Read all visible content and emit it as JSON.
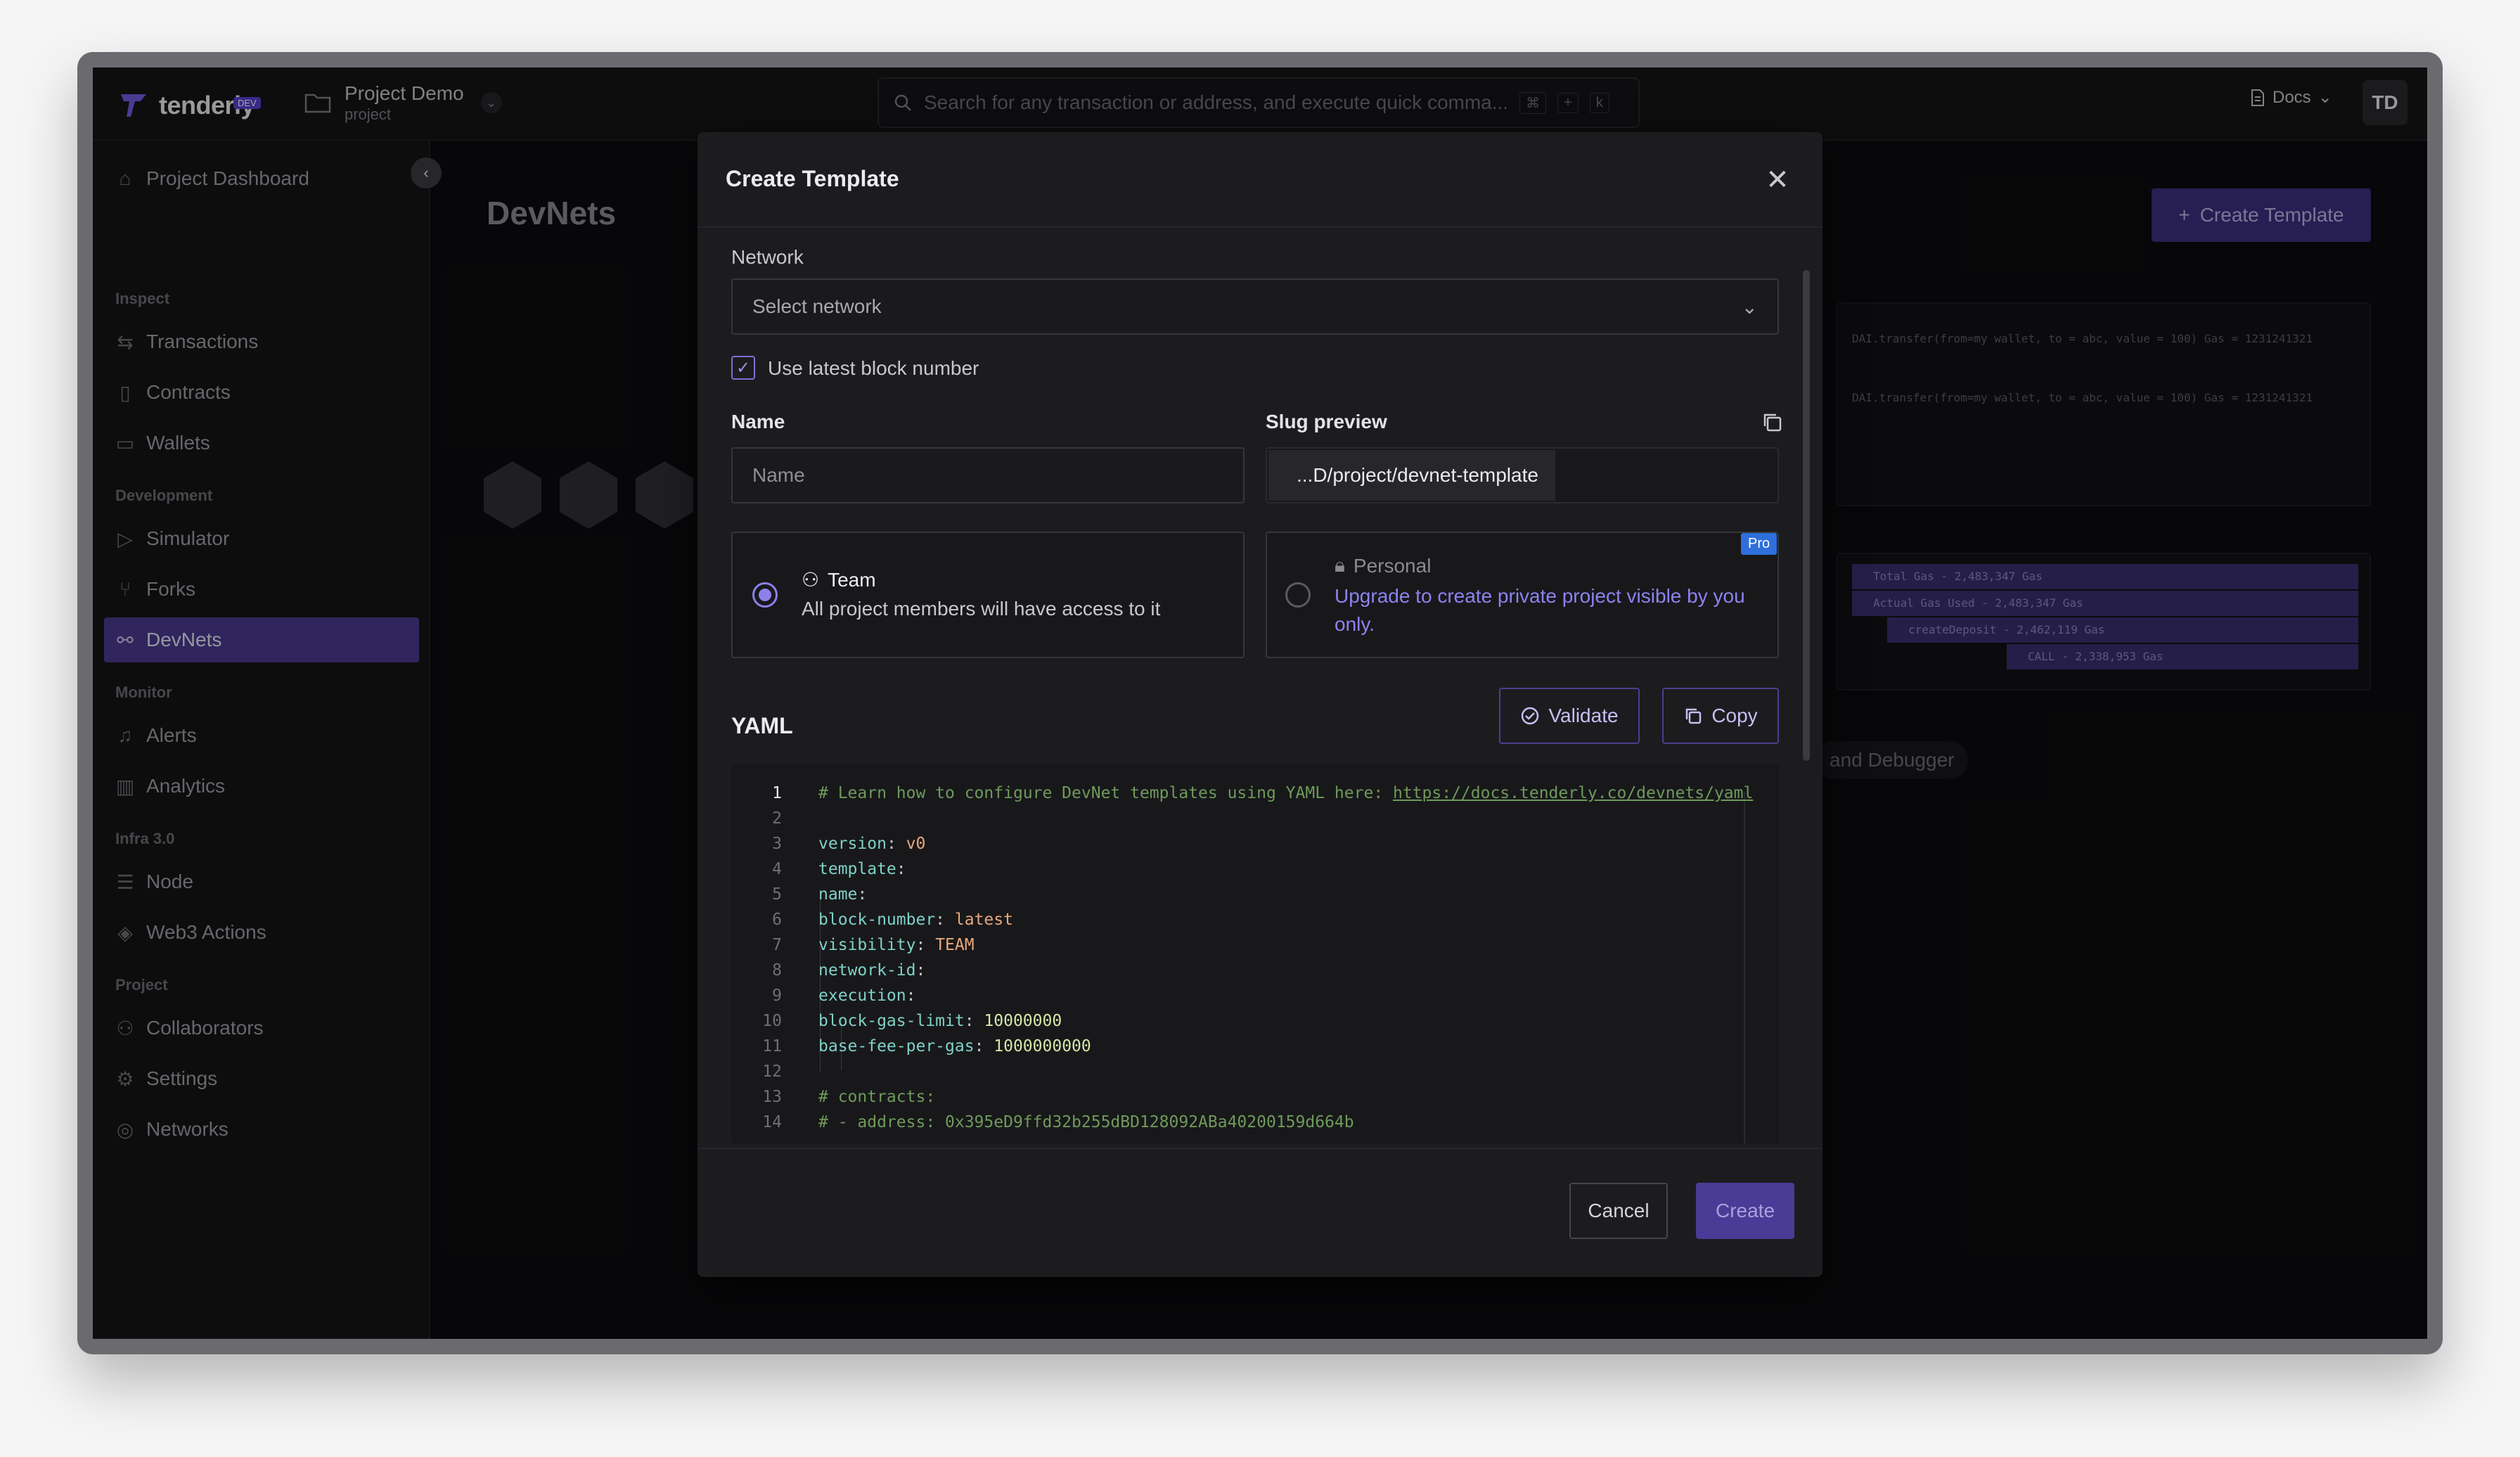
{
  "app": {
    "brand": "tenderly",
    "brand_badge": "DEV",
    "project_name": "Project Demo",
    "project_type": "project",
    "search_placeholder": "Search for any transaction or address, and execute quick comma...",
    "search_kbd": [
      "⌘",
      "+",
      "k"
    ],
    "docs_label": "Docs",
    "user_initials": "TD"
  },
  "sidebar": {
    "top_item": "Project Dashboard",
    "sections": [
      {
        "heading": "Inspect",
        "items": [
          "Transactions",
          "Contracts",
          "Wallets"
        ]
      },
      {
        "heading": "Development",
        "items": [
          "Simulator",
          "Forks",
          "DevNets"
        ]
      },
      {
        "heading": "Monitor",
        "items": [
          "Alerts",
          "Analytics"
        ]
      },
      {
        "heading": "Infra 3.0",
        "items": [
          "Node",
          "Web3 Actions"
        ]
      },
      {
        "heading": "Project",
        "items": [
          "Collaborators",
          "Settings",
          "Networks"
        ]
      }
    ],
    "active_item": "DevNets"
  },
  "page": {
    "title": "DevNets",
    "create_button": "Create Template",
    "debugger_pill": "and Debugger",
    "trace_lines": [
      "DAI.transfer(from=my wallet, to = abc, value = 100)      Gas = 1231241321",
      "DAI.transfer(from=my wallet, to = abc, value = 100)      Gas = 1231241321"
    ],
    "gas_bars": [
      "Total Gas - 2,483,347 Gas",
      "Actual Gas Used - 2,483,347 Gas",
      "createDeposit - 2,462,119 Gas",
      "CALL - 2,338,953 Gas"
    ]
  },
  "modal": {
    "title": "Create Template",
    "network_label": "Network",
    "network_placeholder": "Select network",
    "latest_block_label": "Use latest block number",
    "latest_block_checked": true,
    "name_label": "Name",
    "name_placeholder": "Name",
    "slug_label": "Slug preview",
    "slug_value": "...D/project/devnet-template",
    "team_title": "Team",
    "team_desc": "All project members will have access to it",
    "personal_title": "Personal",
    "personal_badge": "Pro",
    "personal_upgrade": "Upgrade to create private project visible by you only.",
    "selected_visibility": "Team",
    "yaml_label": "YAML",
    "validate_label": "Validate",
    "copy_label": "Copy",
    "cancel_label": "Cancel",
    "create_label": "Create",
    "yaml_lines": [
      "# Learn how to configure DevNet templates using YAML here: https://docs.tenderly.co/devnets/yaml",
      "",
      "version: v0",
      "template:",
      "  name:",
      "  block-number: latest",
      "  visibility: TEAM",
      "  network-id:",
      "  execution:",
      "    block-gas-limit: 10000000",
      "    base-fee-per-gas: 1000000000",
      "",
      "#   contracts:",
      "#     - address: 0x395eD9ffd32b255dBD128092ABa40200159d664b"
    ]
  }
}
